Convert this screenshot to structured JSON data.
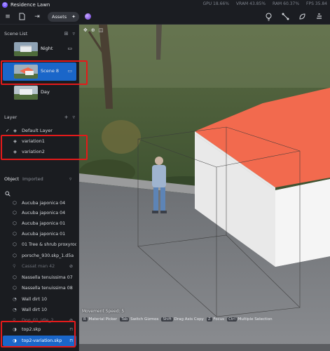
{
  "app": {
    "title": "Residence Lawn",
    "stats": [
      "GPU 18.66%",
      "VRAM 43.85%",
      "RAM 60.37%",
      "FPS 35.84"
    ]
  },
  "toolbar": {
    "assets_label": "Assets"
  },
  "scene_list": {
    "title": "Scene List",
    "items": [
      {
        "label": "Night",
        "active": false
      },
      {
        "label": "Scene 8",
        "active": true
      },
      {
        "label": "Day",
        "active": false
      }
    ]
  },
  "layers": {
    "title": "Layer",
    "items": [
      {
        "label": "Default Layer",
        "checked": true
      },
      {
        "label": "variation1",
        "checked": false
      },
      {
        "label": "variation2",
        "checked": false
      }
    ]
  },
  "object_panel": {
    "tabs": [
      "Object",
      "Imported"
    ],
    "items": [
      {
        "label": "Aucuba japonica 04",
        "dim": false
      },
      {
        "label": "Aucuba japonica 04",
        "dim": false
      },
      {
        "label": "Aucuba japonica 01",
        "dim": false
      },
      {
        "label": "Aucuba japonica 01",
        "dim": false
      },
      {
        "label": "01 Tree & shrub proxyroo...",
        "dim": false
      },
      {
        "label": "porsche_930.skp_1.d5a",
        "dim": false
      },
      {
        "label": "Cassat man 42",
        "dim": true
      },
      {
        "label": "Nassella tenuissima 07",
        "dim": false
      },
      {
        "label": "Nassella tenuissima 08",
        "dim": false
      },
      {
        "label": "Wall dirt 10",
        "dim": false
      },
      {
        "label": "Wall dirt 10",
        "dim": false
      },
      {
        "label": "Dog_01_idle_2",
        "dim": true
      },
      {
        "label": "top2.skp",
        "dim": false
      },
      {
        "label": "top2-variation.skp",
        "dim": false,
        "selected": true
      }
    ]
  },
  "viewport": {
    "speed_text": "Movement Speed: 5",
    "hints": [
      {
        "key": "R",
        "label": "Material Picker"
      },
      {
        "key": "Tab",
        "label": "Switch Gizmos"
      },
      {
        "key": "Shift",
        "label": "Drag Axis Copy"
      },
      {
        "key": "Z",
        "label": "Focus"
      },
      {
        "key": "Ctrl",
        "label": "Multiple Selection"
      }
    ]
  },
  "colors": {
    "accent": "#1a66c9",
    "highlight_box": "#e41a1a",
    "roof": "#f26a4e"
  }
}
